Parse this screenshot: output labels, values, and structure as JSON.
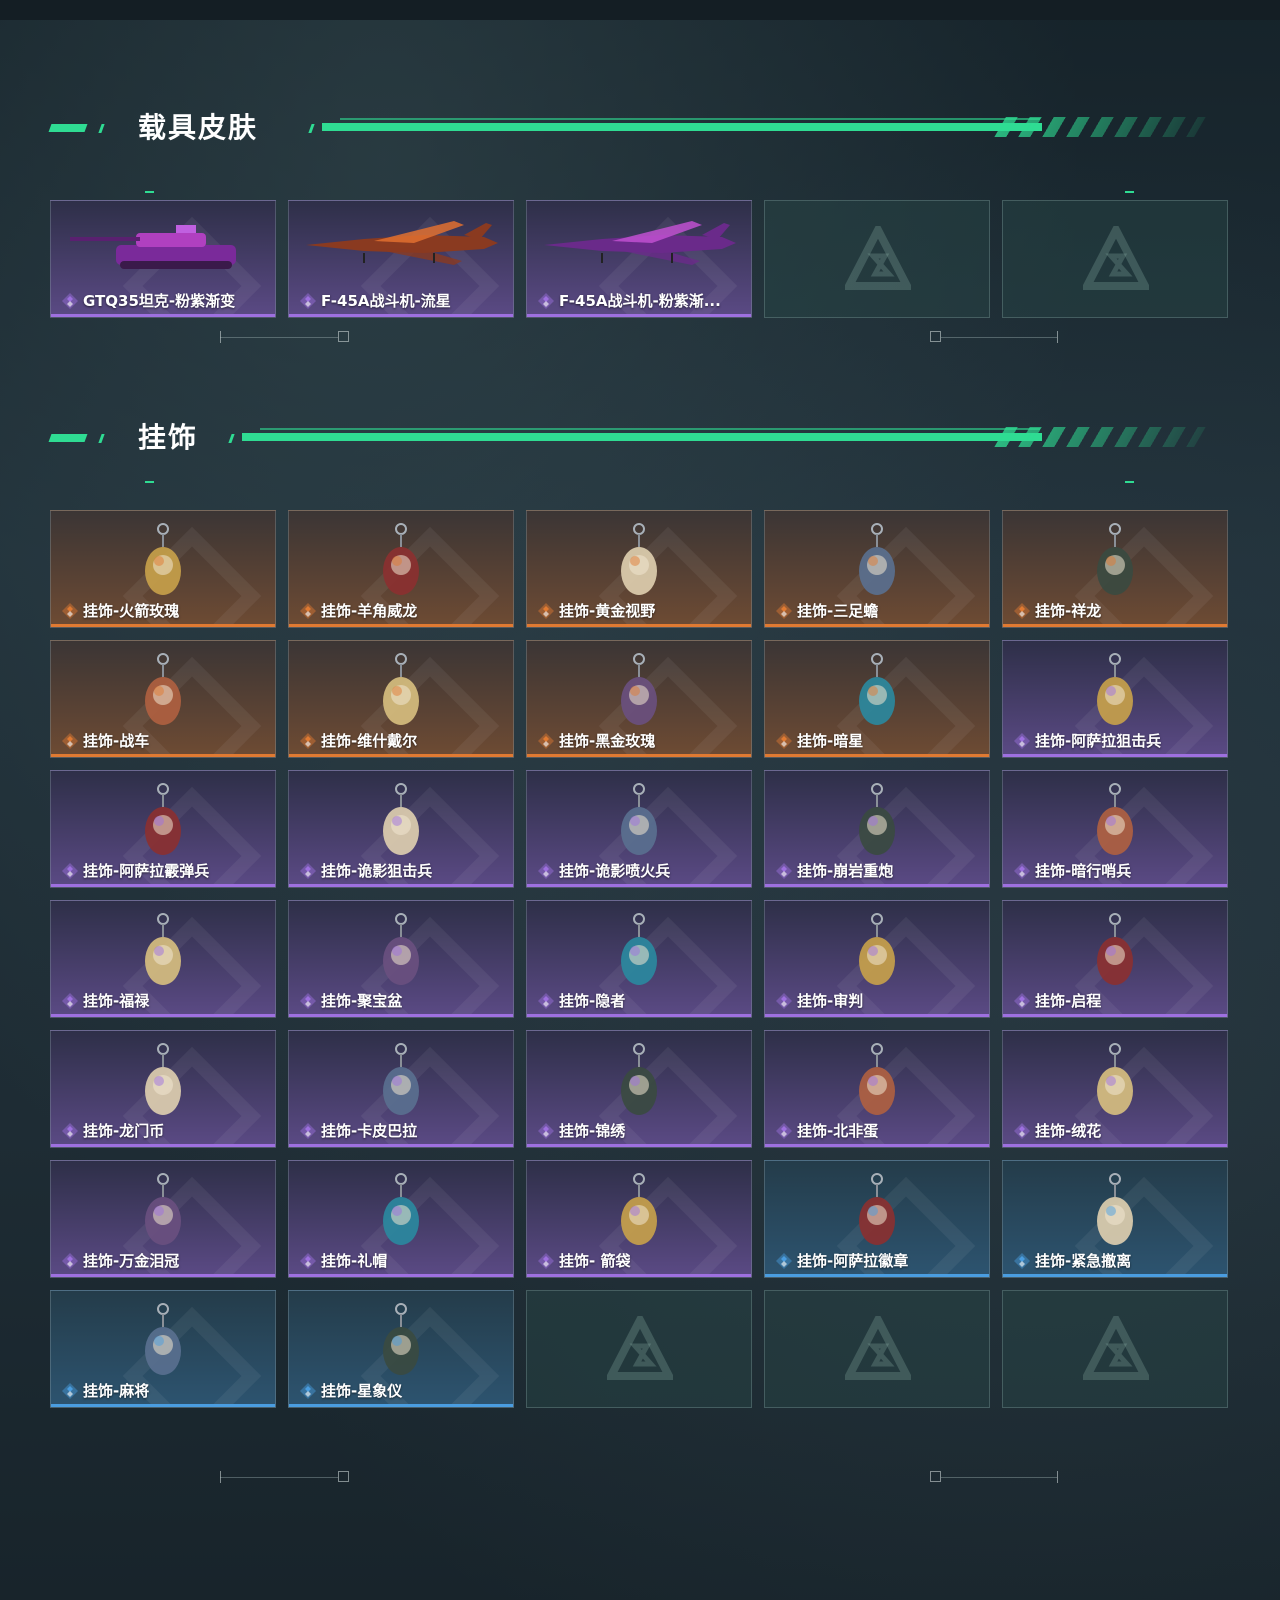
{
  "sections": {
    "vehicle": {
      "title": "载具皮肤"
    },
    "pendant": {
      "title": "挂饰"
    }
  },
  "colors": {
    "accent": "#2fdc93",
    "orange": "#e07a32",
    "purple": "#9e70e0",
    "blue": "#4a9de0"
  },
  "vehicle_items": [
    {
      "label": "GTQ35坦克-粉紫渐变",
      "rarity": "purple",
      "icon": "tank-icon"
    },
    {
      "label": "F-45A战斗机-流星",
      "rarity": "purple",
      "icon": "fighter-jet-icon"
    },
    {
      "label": "F-45A战斗机-粉紫渐...",
      "rarity": "purple",
      "icon": "fighter-jet-icon"
    },
    {
      "label": "",
      "rarity": "empty",
      "icon": "placeholder-logo-icon"
    },
    {
      "label": "",
      "rarity": "empty",
      "icon": "placeholder-logo-icon"
    }
  ],
  "pendant_items": [
    {
      "label": "挂饰-火箭玫瑰",
      "rarity": "orange",
      "icon": "pendant-icon"
    },
    {
      "label": "挂饰-羊角威龙",
      "rarity": "orange",
      "icon": "pendant-icon"
    },
    {
      "label": "挂饰-黄金视野",
      "rarity": "orange",
      "icon": "pendant-icon"
    },
    {
      "label": "挂饰-三足蟾",
      "rarity": "orange",
      "icon": "pendant-icon"
    },
    {
      "label": "挂饰-祥龙",
      "rarity": "orange",
      "icon": "pendant-icon"
    },
    {
      "label": "挂饰-战车",
      "rarity": "orange",
      "icon": "pendant-icon"
    },
    {
      "label": "挂饰-维什戴尔",
      "rarity": "orange",
      "icon": "pendant-icon"
    },
    {
      "label": "挂饰-黑金玫瑰",
      "rarity": "orange",
      "icon": "pendant-icon"
    },
    {
      "label": "挂饰-暗星",
      "rarity": "orange",
      "icon": "pendant-icon"
    },
    {
      "label": "挂饰-阿萨拉狙击兵",
      "rarity": "purple",
      "icon": "pendant-icon"
    },
    {
      "label": "挂饰-阿萨拉霰弹兵",
      "rarity": "purple",
      "icon": "pendant-icon"
    },
    {
      "label": "挂饰-诡影狙击兵",
      "rarity": "purple",
      "icon": "pendant-icon"
    },
    {
      "label": "挂饰-诡影喷火兵",
      "rarity": "purple",
      "icon": "pendant-icon"
    },
    {
      "label": "挂饰-崩岩重炮",
      "rarity": "purple",
      "icon": "pendant-icon"
    },
    {
      "label": "挂饰-暗行哨兵",
      "rarity": "purple",
      "icon": "pendant-icon"
    },
    {
      "label": "挂饰-福禄",
      "rarity": "purple",
      "icon": "pendant-icon"
    },
    {
      "label": "挂饰-聚宝盆",
      "rarity": "purple",
      "icon": "pendant-icon"
    },
    {
      "label": "挂饰-隐者",
      "rarity": "purple",
      "icon": "pendant-icon"
    },
    {
      "label": "挂饰-审判",
      "rarity": "purple",
      "icon": "pendant-icon"
    },
    {
      "label": "挂饰-启程",
      "rarity": "purple",
      "icon": "pendant-icon"
    },
    {
      "label": "挂饰-龙门币",
      "rarity": "purple",
      "icon": "pendant-icon"
    },
    {
      "label": "挂饰-卡皮巴拉",
      "rarity": "purple",
      "icon": "pendant-icon"
    },
    {
      "label": "挂饰-锦绣",
      "rarity": "purple",
      "icon": "pendant-icon"
    },
    {
      "label": "挂饰-北非蛋",
      "rarity": "purple",
      "icon": "pendant-icon"
    },
    {
      "label": "挂饰-绒花",
      "rarity": "purple",
      "icon": "pendant-icon"
    },
    {
      "label": "挂饰-万金泪冠",
      "rarity": "purple",
      "icon": "pendant-icon"
    },
    {
      "label": "挂饰-礼帽",
      "rarity": "purple",
      "icon": "pendant-icon"
    },
    {
      "label": "挂饰- 箭袋",
      "rarity": "purple",
      "icon": "pendant-icon"
    },
    {
      "label": "挂饰-阿萨拉徽章",
      "rarity": "blue",
      "icon": "pendant-icon"
    },
    {
      "label": "挂饰-紧急撤离",
      "rarity": "blue",
      "icon": "pendant-icon"
    },
    {
      "label": "挂饰-麻将",
      "rarity": "blue",
      "icon": "pendant-icon"
    },
    {
      "label": "挂饰-星象仪",
      "rarity": "blue",
      "icon": "pendant-icon"
    },
    {
      "label": "",
      "rarity": "empty",
      "icon": "placeholder-logo-icon"
    },
    {
      "label": "",
      "rarity": "empty",
      "icon": "placeholder-logo-icon"
    },
    {
      "label": "",
      "rarity": "empty",
      "icon": "placeholder-logo-icon"
    }
  ]
}
